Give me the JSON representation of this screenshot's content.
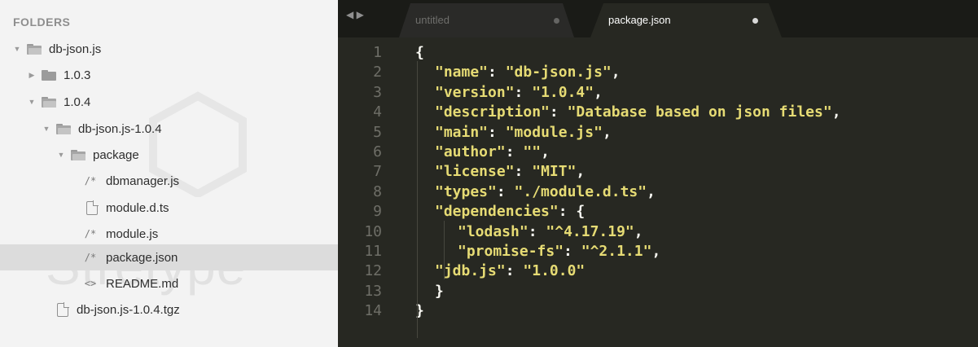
{
  "sidebar": {
    "title": "FOLDERS",
    "items": [
      {
        "label": "db-json.js",
        "kind": "folder-open",
        "icon": "folder-icon"
      },
      {
        "label": "1.0.3",
        "kind": "folder-closed",
        "icon": "folder-icon"
      },
      {
        "label": "1.0.4",
        "kind": "folder-open",
        "icon": "folder-icon"
      },
      {
        "label": "db-json.js-1.0.4",
        "kind": "folder-open",
        "icon": "folder-icon"
      },
      {
        "label": "package",
        "kind": "folder-open",
        "icon": "folder-icon"
      },
      {
        "label": "dbmanager.js",
        "kind": "js-file",
        "glyph": "/*"
      },
      {
        "label": "module.d.ts",
        "kind": "file",
        "icon": "file-icon"
      },
      {
        "label": "module.js",
        "kind": "js-file",
        "glyph": "/*"
      },
      {
        "label": "package.json",
        "kind": "js-file",
        "glyph": "/*",
        "selected": true
      },
      {
        "label": "README.md",
        "kind": "markup-file",
        "glyph": "<>"
      },
      {
        "label": "db-json.js-1.0.4.tgz",
        "kind": "file",
        "icon": "file-icon"
      }
    ],
    "watermark": "Stretype"
  },
  "tabs": {
    "nav_glyph": "◀ ▶",
    "items": [
      {
        "label": "untitled",
        "active": false
      },
      {
        "label": "package.json",
        "active": true
      }
    ]
  },
  "editor": {
    "line_numbers": [
      "1",
      "2",
      "3",
      "4",
      "5",
      "6",
      "7",
      "8",
      "9",
      "10",
      "11",
      "12",
      "13",
      "14"
    ],
    "lines": [
      {
        "key": null,
        "text": "{"
      },
      {
        "key": "\"name\"",
        "value": "\"db-json.js\"",
        "tail": ","
      },
      {
        "key": "\"version\"",
        "value": "\"1.0.4\"",
        "tail": ","
      },
      {
        "key": "\"description\"",
        "value": "\"Database based on json files\"",
        "tail": ","
      },
      {
        "key": "\"main\"",
        "value": "\"module.js\"",
        "tail": ","
      },
      {
        "key": "\"author\"",
        "value": "\"\"",
        "tail": ","
      },
      {
        "key": "\"license\"",
        "value": "\"MIT\"",
        "tail": ","
      },
      {
        "key": "\"types\"",
        "value": "\"./module.d.ts\"",
        "tail": ","
      },
      {
        "key": "\"dependencies\"",
        "value": "{",
        "tail": ""
      },
      {
        "key": "\"lodash\"",
        "value": "\"^4.17.19\"",
        "tail": ","
      },
      {
        "key": "\"promise-fs\"",
        "value": "\"^2.1.1\"",
        "tail": ","
      },
      {
        "key": "\"jdb.js\"",
        "value": "\"1.0.0\"",
        "tail": ""
      },
      {
        "key": null,
        "text": "}"
      },
      {
        "key": null,
        "text": "}"
      }
    ]
  },
  "colors": {
    "editor_bg": "#272822",
    "string": "#e6db74",
    "text": "#f8f8f2",
    "gutter": "#6e6e67",
    "sidebar_bg": "#f3f3f3",
    "selection": "#dcdcdc"
  }
}
